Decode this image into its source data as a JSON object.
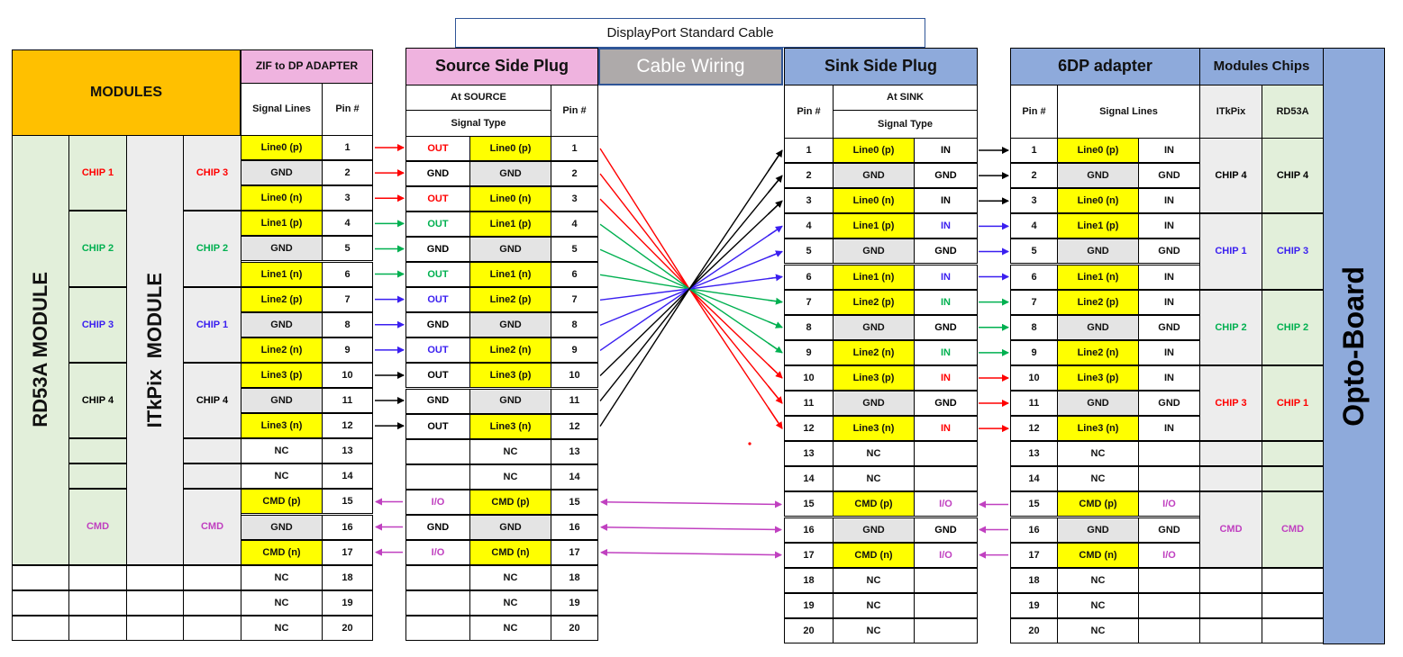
{
  "title": "DisplayPort Standard Cable",
  "cable_wiring_label": "Cable Wiring",
  "left": {
    "modules_label": "MODULES",
    "zif_label": "ZIF to DP ADAPTER",
    "signal_lines_label": "Signal Lines",
    "pin_label": "Pin #",
    "rd53a_label": "RD53A MODULE",
    "itkpix_label": "ITkPix  MODULE",
    "rd53a_groups": [
      {
        "label": "CHIP 1",
        "color": "red"
      },
      {
        "label": "CHIP 2",
        "color": "green"
      },
      {
        "label": "CHIP 3",
        "color": "blue"
      },
      {
        "label": "CHIP 4",
        "color": "black"
      },
      {
        "label": "CMD",
        "color": "purple"
      }
    ],
    "itkpix_groups": [
      {
        "label": "CHIP 3",
        "color": "red"
      },
      {
        "label": "CHIP 2",
        "color": "green"
      },
      {
        "label": "CHIP 1",
        "color": "blue"
      },
      {
        "label": "CHIP 4",
        "color": "black"
      },
      {
        "label": "CMD",
        "color": "purple"
      }
    ]
  },
  "source": {
    "title": "Source Side Plug",
    "at_label": "At SOURCE",
    "type_label": "Signal Type",
    "pin_label": "Pin #"
  },
  "sink": {
    "title": "Sink Side Plug",
    "at_label": "At SINK",
    "type_label": "Signal Type",
    "pin_label": "Pin #"
  },
  "dp6": {
    "title": "6DP adapter",
    "pin_label": "Pin #",
    "signal_lines_label": "Signal Lines"
  },
  "module_chips": {
    "title": "Modules Chips",
    "itkpix_label": "ITkPix",
    "rd53a_label": "RD53A",
    "itkpix_groups": [
      {
        "label": "CHIP 4",
        "color": "black"
      },
      {
        "label": "CHIP 1",
        "color": "blue"
      },
      {
        "label": "CHIP 2",
        "color": "green"
      },
      {
        "label": "CHIP 3",
        "color": "red"
      },
      {
        "label": "CMD",
        "color": "purple"
      }
    ],
    "rd53a_groups": [
      {
        "label": "CHIP 4",
        "color": "black"
      },
      {
        "label": "CHIP 3",
        "color": "blue"
      },
      {
        "label": "CHIP 2",
        "color": "green"
      },
      {
        "label": "CHIP 1",
        "color": "red"
      },
      {
        "label": "CMD",
        "color": "purple"
      }
    ]
  },
  "opto_board_label": "Opto-Board",
  "colors": {
    "red": "#ff0000",
    "green": "#00b050",
    "blue": "#3a1ff0",
    "black": "#000000",
    "purple": "#c040c0"
  },
  "pins": [
    {
      "pin": "1",
      "signal": "Line0 (p)",
      "fill": "y",
      "src_type": "OUT",
      "src_color": "red",
      "sink_type": "IN",
      "sink_color": "black",
      "dp6_type": "IN"
    },
    {
      "pin": "2",
      "signal": "GND",
      "fill": "g",
      "src_type": "GND",
      "src_color": "black",
      "sink_type": "GND",
      "sink_color": "black",
      "dp6_type": "GND"
    },
    {
      "pin": "3",
      "signal": "Line0 (n)",
      "fill": "y",
      "src_type": "OUT",
      "src_color": "red",
      "sink_type": "IN",
      "sink_color": "black",
      "dp6_type": "IN"
    },
    {
      "pin": "4",
      "signal": "Line1 (p)",
      "fill": "y",
      "src_type": "OUT",
      "src_color": "green",
      "sink_type": "IN",
      "sink_color": "blue",
      "dp6_type": "IN"
    },
    {
      "pin": "5",
      "signal": "GND",
      "fill": "g",
      "src_type": "GND",
      "src_color": "black",
      "sink_type": "GND",
      "sink_color": "black",
      "dp6_type": "GND"
    },
    {
      "pin": "6",
      "signal": "Line1 (n)",
      "fill": "y",
      "src_type": "OUT",
      "src_color": "green",
      "sink_type": "IN",
      "sink_color": "blue",
      "dp6_type": "IN"
    },
    {
      "pin": "7",
      "signal": "Line2 (p)",
      "fill": "y",
      "src_type": "OUT",
      "src_color": "blue",
      "sink_type": "IN",
      "sink_color": "green",
      "dp6_type": "IN"
    },
    {
      "pin": "8",
      "signal": "GND",
      "fill": "g",
      "src_type": "GND",
      "src_color": "black",
      "sink_type": "GND",
      "sink_color": "black",
      "dp6_type": "GND"
    },
    {
      "pin": "9",
      "signal": "Line2 (n)",
      "fill": "y",
      "src_type": "OUT",
      "src_color": "blue",
      "sink_type": "IN",
      "sink_color": "green",
      "dp6_type": "IN"
    },
    {
      "pin": "10",
      "signal": "Line3 (p)",
      "fill": "y",
      "src_type": "OUT",
      "src_color": "black",
      "sink_type": "IN",
      "sink_color": "red",
      "dp6_type": "IN"
    },
    {
      "pin": "11",
      "signal": "GND",
      "fill": "g",
      "src_type": "GND",
      "src_color": "black",
      "sink_type": "GND",
      "sink_color": "black",
      "dp6_type": "GND"
    },
    {
      "pin": "12",
      "signal": "Line3 (n)",
      "fill": "y",
      "src_type": "OUT",
      "src_color": "black",
      "sink_type": "IN",
      "sink_color": "red",
      "dp6_type": "IN"
    },
    {
      "pin": "13",
      "signal": "NC",
      "fill": "w",
      "src_type": "",
      "src_color": "black",
      "sink_type": "",
      "sink_color": "black",
      "dp6_type": ""
    },
    {
      "pin": "14",
      "signal": "NC",
      "fill": "w",
      "src_type": "",
      "src_color": "black",
      "sink_type": "",
      "sink_color": "black",
      "dp6_type": ""
    },
    {
      "pin": "15",
      "signal": "CMD (p)",
      "fill": "y",
      "src_type": "I/O",
      "src_color": "purple",
      "sink_type": "I/O",
      "sink_color": "purple",
      "dp6_type": "I/O"
    },
    {
      "pin": "16",
      "signal": "GND",
      "fill": "g",
      "src_type": "GND",
      "src_color": "black",
      "sink_type": "GND",
      "sink_color": "black",
      "dp6_type": "GND"
    },
    {
      "pin": "17",
      "signal": "CMD (n)",
      "fill": "y",
      "src_type": "I/O",
      "src_color": "purple",
      "sink_type": "I/O",
      "sink_color": "purple",
      "dp6_type": "I/O"
    },
    {
      "pin": "18",
      "signal": "NC",
      "fill": "w",
      "src_type": "",
      "src_color": "black",
      "sink_type": "",
      "sink_color": "black",
      "dp6_type": ""
    },
    {
      "pin": "19",
      "signal": "NC",
      "fill": "w",
      "src_type": "",
      "src_color": "black",
      "sink_type": "",
      "sink_color": "black",
      "dp6_type": ""
    },
    {
      "pin": "20",
      "signal": "NC",
      "fill": "w",
      "src_type": "",
      "src_color": "black",
      "sink_type": "",
      "sink_color": "black",
      "dp6_type": ""
    }
  ],
  "wiring": {
    "crossover": [
      {
        "from_pin": 1,
        "to_pin": 10,
        "color": "red"
      },
      {
        "from_pin": 2,
        "to_pin": 11,
        "color": "red"
      },
      {
        "from_pin": 3,
        "to_pin": 12,
        "color": "red"
      },
      {
        "from_pin": 4,
        "to_pin": 7,
        "color": "green"
      },
      {
        "from_pin": 5,
        "to_pin": 8,
        "color": "green"
      },
      {
        "from_pin": 6,
        "to_pin": 9,
        "color": "green"
      },
      {
        "from_pin": 7,
        "to_pin": 4,
        "color": "blue"
      },
      {
        "from_pin": 8,
        "to_pin": 5,
        "color": "blue"
      },
      {
        "from_pin": 9,
        "to_pin": 6,
        "color": "blue"
      },
      {
        "from_pin": 10,
        "to_pin": 1,
        "color": "black"
      },
      {
        "from_pin": 11,
        "to_pin": 2,
        "color": "black"
      },
      {
        "from_pin": 12,
        "to_pin": 3,
        "color": "black"
      }
    ],
    "bidirectional": [
      15,
      16,
      17
    ]
  }
}
